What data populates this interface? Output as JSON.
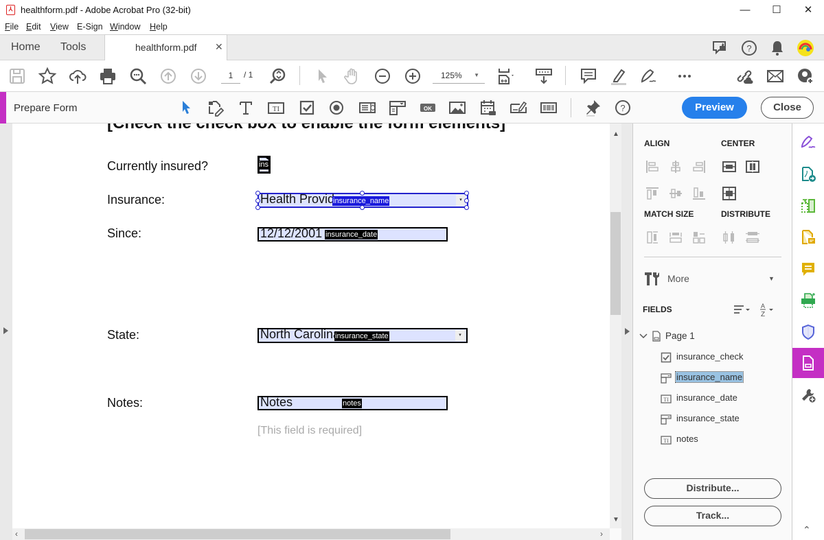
{
  "window": {
    "title": "healthform.pdf - Adobe Acrobat Pro (32-bit)",
    "controls": {
      "minimize": "—",
      "maximize": "☐",
      "close": "✕"
    }
  },
  "menubar": {
    "items": [
      {
        "label": "File",
        "accel": "F",
        "rest": "ile"
      },
      {
        "label": "Edit",
        "accel": "E",
        "rest": "dit"
      },
      {
        "label": "View",
        "accel": "V",
        "rest": "iew"
      },
      {
        "label": "E-Sign",
        "accel": "",
        "rest": "E-Sign"
      },
      {
        "label": "Window",
        "accel": "W",
        "rest": "indow"
      },
      {
        "label": "Help",
        "accel": "H",
        "rest": "elp"
      }
    ]
  },
  "tabs": {
    "home": "Home",
    "tools": "Tools",
    "document": "healthform.pdf",
    "close_glyph": "✕"
  },
  "toolbar": {
    "page_current": "1",
    "page_total": "/ 1",
    "zoom": "125%",
    "icons": [
      "save-icon",
      "bookmark-star-icon",
      "upload-cloud-icon",
      "print-icon",
      "find-icon",
      "prev-page-icon",
      "next-page-icon",
      "zoom-find-icon",
      "select-arrow-icon",
      "hand-icon",
      "zoom-out-icon",
      "zoom-in-icon",
      "fit-page-icon",
      "scroll-mode-icon",
      "comment-icon",
      "highlight-icon",
      "sign-icon",
      "more-tools-icon",
      "share-link-icon",
      "email-icon",
      "add-user-icon"
    ]
  },
  "prepare_form": {
    "title": "Prepare Form",
    "preview": "Preview",
    "close": "Close",
    "tools": [
      "select-object",
      "edit-fields",
      "add-text",
      "text-field",
      "checkbox",
      "radio-button",
      "list-box",
      "dropdown",
      "button",
      "image",
      "date-field",
      "digital-signature",
      "barcode",
      "pin",
      "help"
    ]
  },
  "document": {
    "heading": "[Check the check box to enable the form elements]",
    "rows": [
      {
        "label": "Currently insured?",
        "field_name": "insurance_check",
        "tag": "ins",
        "type": "checkbox"
      },
      {
        "label": "Insurance:",
        "field_name": "insurance_name",
        "value": "Health Provid",
        "tag": "insurance_name",
        "type": "dropdown",
        "selected": true
      },
      {
        "label": "Since:",
        "field_name": "insurance_date",
        "value": "12/12/2001",
        "tag": "insurance_date",
        "type": "date"
      },
      {
        "label": "State:",
        "field_name": "insurance_state",
        "value": "North Carolina",
        "tag": "insurance_state",
        "type": "dropdown"
      },
      {
        "label": "Notes:",
        "field_name": "notes",
        "value": "Notes",
        "tag": "notes",
        "type": "text"
      }
    ],
    "required_hint": "[This field is required]",
    "dropdown_glyph": "▾"
  },
  "right_panel": {
    "align_title": "ALIGN",
    "center_title": "CENTER",
    "match_size_title": "MATCH SIZE",
    "distribute_title": "DISTRIBUTE",
    "more_label": "More",
    "fields_title": "FIELDS",
    "page_node": "Page 1",
    "fields": [
      {
        "name": "insurance_check",
        "icon": "checkbox-field-icon",
        "selected": false
      },
      {
        "name": "insurance_name",
        "icon": "dropdown-field-icon",
        "selected": true
      },
      {
        "name": "insurance_date",
        "icon": "text-field-icon",
        "selected": false
      },
      {
        "name": "insurance_state",
        "icon": "dropdown-field-icon",
        "selected": false
      },
      {
        "name": "notes",
        "icon": "text-field-icon",
        "selected": false
      }
    ],
    "distribute_button": "Distribute...",
    "track_button": "Track..."
  },
  "tool_rail": {
    "items": [
      "fill-sign",
      "export-pdf",
      "organize-pages",
      "create-pdf",
      "comment",
      "print-production",
      "protect",
      "prepare-form",
      "more-tools"
    ],
    "active": "prepare-form",
    "colors": {
      "fill-sign": "#8a4fd8",
      "export-pdf": "#1d8b8b",
      "organize-pages": "#5cb83a",
      "create-pdf": "#e0a800",
      "comment": "#e0b000",
      "print-production": "#2fa84f",
      "protect": "#5563d8",
      "prepare-form": "#c42fc4",
      "more-tools": "#555555"
    }
  },
  "colors": {
    "accent": "#c42fc4",
    "primary_button": "#2680eb",
    "field_fill": "#dde3ff",
    "selection": "#2222cc"
  }
}
